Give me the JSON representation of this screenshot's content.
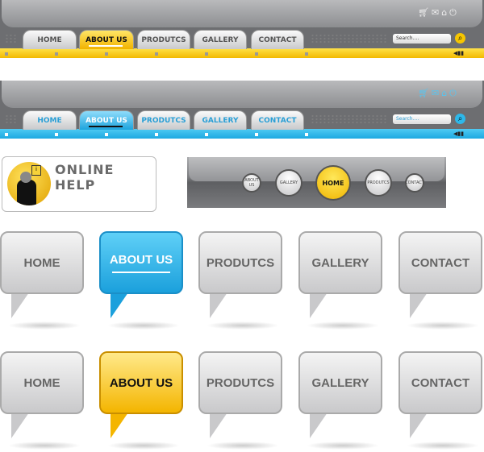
{
  "nav_items": [
    "HOME",
    "ABOUT US",
    "PRODUTCS",
    "GALLERY",
    "CONTACT"
  ],
  "search_placeholder": "Search....",
  "top_icons": [
    "cart-icon",
    "mail-icon",
    "home-icon",
    "power-icon"
  ],
  "bar_yellow": {
    "active": "ABOUT US",
    "accent": "#f7c600"
  },
  "bar_blue": {
    "active": "ABOUT US",
    "accent": "#2db8ea"
  },
  "help": {
    "title": "ONLINE HELP"
  },
  "circle_nav": [
    "ABOUT US",
    "GALLERY",
    "HOME",
    "PRODUTCS",
    "CONTACT"
  ],
  "circle_active": "HOME"
}
